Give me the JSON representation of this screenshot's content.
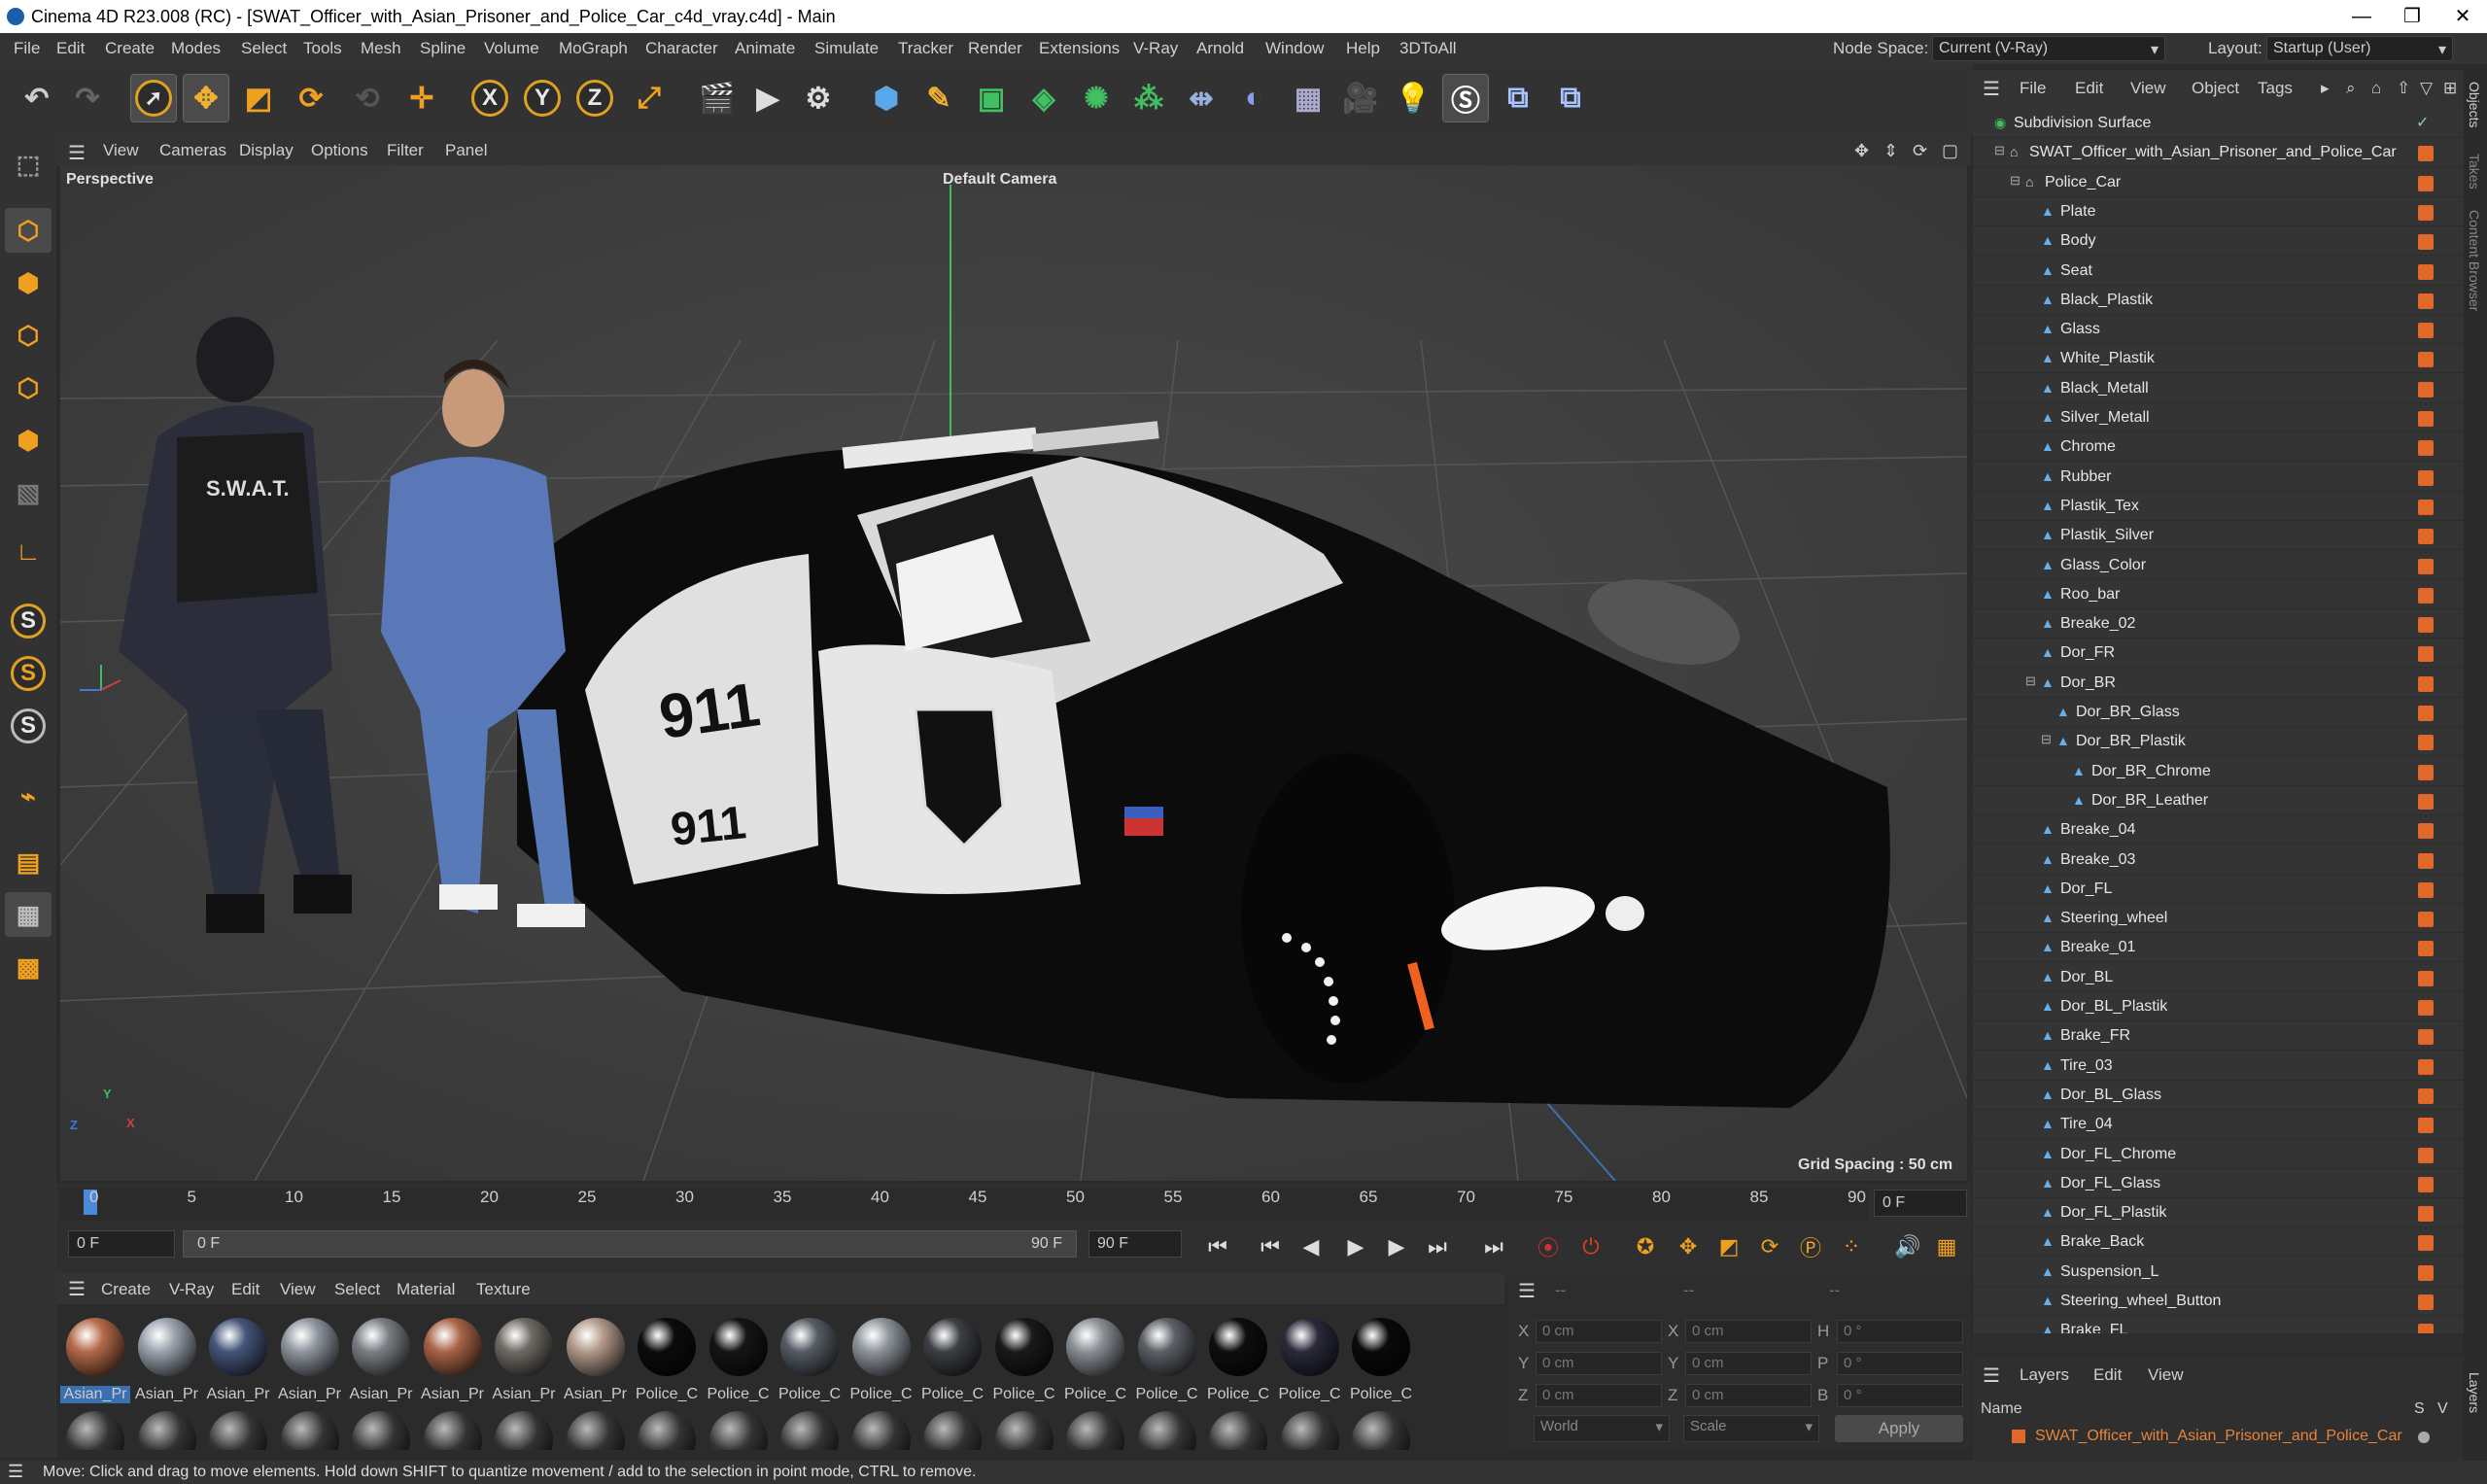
{
  "window": {
    "title": "Cinema 4D R23.008 (RC) - [SWAT_Officer_with_Asian_Prisoner_and_Police_Car_c4d_vray.c4d] - Main",
    "controls": [
      "—",
      "❐",
      "✕"
    ]
  },
  "menubar": {
    "items": [
      "File",
      "Edit",
      "Create",
      "Modes",
      "Select",
      "Tools",
      "Mesh",
      "Spline",
      "Volume",
      "MoGraph",
      "Character",
      "Animate",
      "Simulate",
      "Tracker",
      "Render",
      "Extensions",
      "V-Ray",
      "Arnold",
      "Window",
      "Help",
      "3DToAll"
    ],
    "node_space_label": "Node Space:",
    "node_space_value": "Current (V-Ray)",
    "layout_label": "Layout:",
    "layout_value": "Startup (User)"
  },
  "toolbar": {
    "axis_x": "X",
    "axis_y": "Y",
    "axis_z": "Z"
  },
  "left_toolbar": {
    "s1": "S",
    "s2": "S",
    "s3": "S"
  },
  "viewport": {
    "menu": [
      "View",
      "Cameras",
      "Display",
      "Options",
      "Filter",
      "Panel"
    ],
    "projection": "Perspective",
    "camera": "Default Camera",
    "grid_spacing": "Grid Spacing : 50 cm",
    "axis_labels": {
      "x": "X",
      "y": "Y",
      "z": "Z"
    },
    "car_unit_text": "911",
    "vest_text": "S.W.A.T."
  },
  "timeline": {
    "ticks": [
      "0",
      "5",
      "10",
      "15",
      "20",
      "25",
      "30",
      "35",
      "40",
      "45",
      "50",
      "55",
      "60",
      "65",
      "70",
      "75",
      "80",
      "85",
      "90"
    ],
    "current_frame": "0 F",
    "start_frame": "0 F",
    "range_start": "0 F",
    "range_end": "90 F",
    "end_frame": "90 F"
  },
  "material_manager": {
    "menu": [
      "Create",
      "V-Ray",
      "Edit",
      "View",
      "Select",
      "Material",
      "Texture"
    ],
    "materials": [
      {
        "label": "Asian_Pr",
        "color": "#b56a4a"
      },
      {
        "label": "Asian_Pr",
        "color": "#9aa3ad"
      },
      {
        "label": "Asian_Pr",
        "color": "#45557a"
      },
      {
        "label": "Asian_Pr",
        "color": "#8f969f"
      },
      {
        "label": "Asian_Pr",
        "color": "#7b7f85"
      },
      {
        "label": "Asian_Pr",
        "color": "#a86447"
      },
      {
        "label": "Asian_Pr",
        "color": "#6f6a64"
      },
      {
        "label": "Asian_Pr",
        "color": "#b29a8a"
      },
      {
        "label": "Police_C",
        "color": "#0c0c0c"
      },
      {
        "label": "Police_C",
        "color": "#151515"
      },
      {
        "label": "Police_C",
        "color": "#555c64"
      },
      {
        "label": "Police_C",
        "color": "#8d949b"
      },
      {
        "label": "Police_C",
        "color": "#3c3f44"
      },
      {
        "label": "Police_C",
        "color": "#1a1a1a"
      },
      {
        "label": "Police_C",
        "color": "#8a9096"
      },
      {
        "label": "Police_C",
        "color": "#5b6066"
      },
      {
        "label": "Police_C",
        "color": "#0e0e0e"
      },
      {
        "label": "Police_C",
        "color": "#2a2a3a"
      },
      {
        "label": "Police_C",
        "color": "#0a0a0a"
      }
    ]
  },
  "coordinates": {
    "header_a": "--",
    "header_b": "--",
    "header_c": "--",
    "rows": [
      {
        "l1": "X",
        "v1": "0 cm",
        "l2": "X",
        "v2": "0 cm",
        "l3": "H",
        "v3": "0 °"
      },
      {
        "l1": "Y",
        "v1": "0 cm",
        "l2": "Y",
        "v2": "0 cm",
        "l3": "P",
        "v3": "0 °"
      },
      {
        "l1": "Z",
        "v1": "0 cm",
        "l2": "Z",
        "v2": "0 cm",
        "l3": "B",
        "v3": "0 °"
      }
    ],
    "mode": "World",
    "scale": "Scale",
    "apply": "Apply"
  },
  "object_manager": {
    "menu": [
      "File",
      "Edit",
      "View",
      "Object",
      "Tags"
    ],
    "objects": [
      {
        "name": "Subdivision Surface",
        "level": 0,
        "type": "subd"
      },
      {
        "name": "SWAT_Officer_with_Asian_Prisoner_and_Police_Car",
        "level": 1,
        "type": "null"
      },
      {
        "name": "Police_Car",
        "level": 2,
        "type": "null"
      },
      {
        "name": "Plate",
        "level": 3,
        "type": "poly"
      },
      {
        "name": "Body",
        "level": 3,
        "type": "poly"
      },
      {
        "name": "Seat",
        "level": 3,
        "type": "poly"
      },
      {
        "name": "Black_Plastik",
        "level": 3,
        "type": "poly"
      },
      {
        "name": "Glass",
        "level": 3,
        "type": "poly"
      },
      {
        "name": "White_Plastik",
        "level": 3,
        "type": "poly"
      },
      {
        "name": "Black_Metall",
        "level": 3,
        "type": "poly"
      },
      {
        "name": "Silver_Metall",
        "level": 3,
        "type": "poly"
      },
      {
        "name": "Chrome",
        "level": 3,
        "type": "poly"
      },
      {
        "name": "Rubber",
        "level": 3,
        "type": "poly"
      },
      {
        "name": "Plastik_Tex",
        "level": 3,
        "type": "poly"
      },
      {
        "name": "Plastik_Silver",
        "level": 3,
        "type": "poly"
      },
      {
        "name": "Glass_Color",
        "level": 3,
        "type": "poly"
      },
      {
        "name": "Roo_bar",
        "level": 3,
        "type": "poly"
      },
      {
        "name": "Breake_02",
        "level": 3,
        "type": "poly"
      },
      {
        "name": "Dor_FR",
        "level": 3,
        "type": "poly"
      },
      {
        "name": "Dor_BR",
        "level": 3,
        "type": "poly"
      },
      {
        "name": "Dor_BR_Glass",
        "level": 4,
        "type": "poly"
      },
      {
        "name": "Dor_BR_Plastik",
        "level": 4,
        "type": "poly"
      },
      {
        "name": "Dor_BR_Chrome",
        "level": 5,
        "type": "poly"
      },
      {
        "name": "Dor_BR_Leather",
        "level": 5,
        "type": "poly"
      },
      {
        "name": "Breake_04",
        "level": 3,
        "type": "poly"
      },
      {
        "name": "Breake_03",
        "level": 3,
        "type": "poly"
      },
      {
        "name": "Dor_FL",
        "level": 3,
        "type": "poly"
      },
      {
        "name": "Steering_wheel",
        "level": 3,
        "type": "poly"
      },
      {
        "name": "Breake_01",
        "level": 3,
        "type": "poly"
      },
      {
        "name": "Dor_BL",
        "level": 3,
        "type": "poly"
      },
      {
        "name": "Dor_BL_Plastik",
        "level": 3,
        "type": "poly"
      },
      {
        "name": "Brake_FR",
        "level": 3,
        "type": "poly"
      },
      {
        "name": "Tire_03",
        "level": 3,
        "type": "poly"
      },
      {
        "name": "Dor_BL_Glass",
        "level": 3,
        "type": "poly"
      },
      {
        "name": "Tire_04",
        "level": 3,
        "type": "poly"
      },
      {
        "name": "Dor_FL_Chrome",
        "level": 3,
        "type": "poly"
      },
      {
        "name": "Dor_FL_Glass",
        "level": 3,
        "type": "poly"
      },
      {
        "name": "Dor_FL_Plastik",
        "level": 3,
        "type": "poly"
      },
      {
        "name": "Brake_Back",
        "level": 3,
        "type": "poly"
      },
      {
        "name": "Suspension_L",
        "level": 3,
        "type": "poly"
      },
      {
        "name": "Steering_wheel_Button",
        "level": 3,
        "type": "poly"
      },
      {
        "name": "Brake_FL",
        "level": 3,
        "type": "poly"
      }
    ]
  },
  "layers": {
    "menu": [
      "Layers",
      "Edit",
      "View"
    ],
    "col_name": "Name",
    "col_s": "S",
    "col_v": "V",
    "item": "SWAT_Officer_with_Asian_Prisoner_and_Police_Car"
  },
  "side_tabs": [
    "Objects",
    "Takes",
    "Content Browser",
    "Layers"
  ],
  "statusbar": {
    "text": "Move: Click and drag to move elements. Hold down SHIFT to quantize movement / add to the selection in point mode, CTRL to remove."
  },
  "colors": {
    "accent_orange": "#e0692a",
    "object_text": "#e6e6e6",
    "layer_text": "#e8843a"
  }
}
